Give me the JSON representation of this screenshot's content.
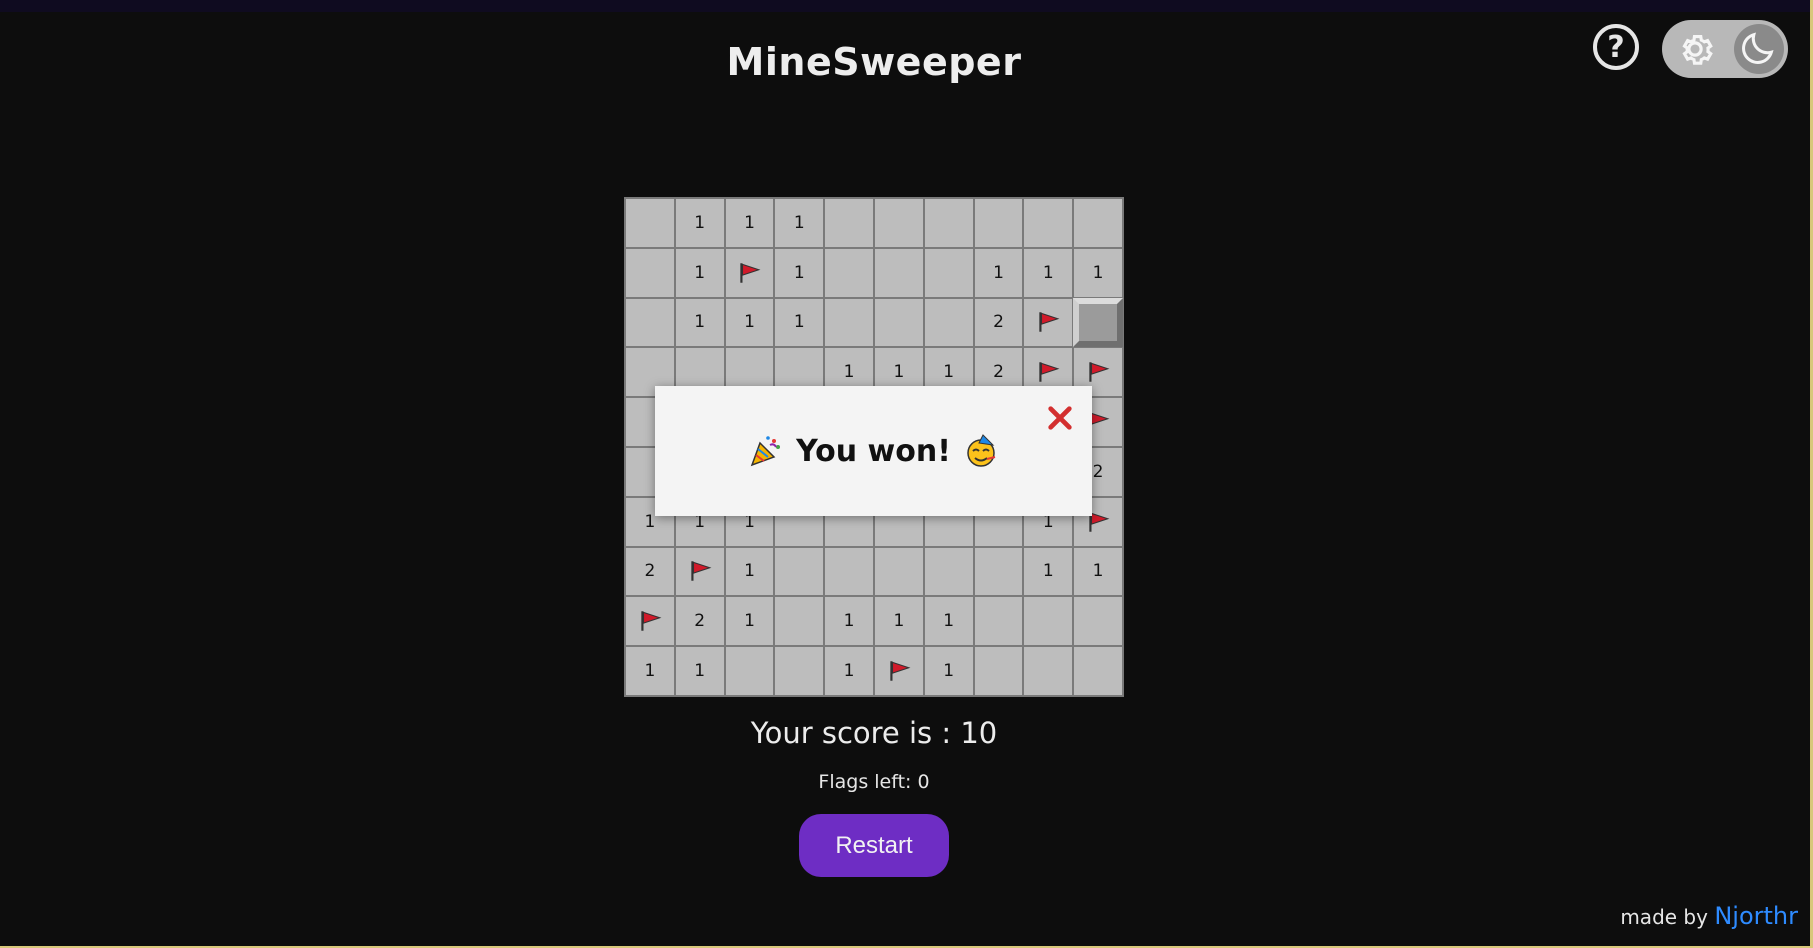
{
  "app": {
    "title": "MineSweeper"
  },
  "header": {
    "help_icon": "question-circle-icon",
    "help_label": "?",
    "theme_toggle": {
      "left_icon": "gear-icon",
      "right_icon": "moon-icon",
      "state": "dark"
    }
  },
  "board": {
    "rows": 10,
    "cols": 10,
    "cells": [
      [
        "",
        "1",
        "1",
        "1",
        "",
        "",
        "",
        "",
        "",
        ""
      ],
      [
        "",
        "1",
        "F",
        "1",
        "",
        "",
        "",
        "1",
        "1",
        "1"
      ],
      [
        "",
        "1",
        "1",
        "1",
        "",
        "",
        "",
        "2",
        "F",
        "#"
      ],
      [
        "",
        "",
        "",
        "",
        "1",
        "1",
        "1",
        "2",
        "F",
        "F"
      ],
      [
        "",
        "",
        "",
        "",
        "",
        "",
        "",
        "",
        "",
        "F"
      ],
      [
        "",
        "",
        "",
        "",
        "",
        "",
        "",
        "",
        "",
        "2"
      ],
      [
        "1",
        "1",
        "1",
        "",
        "",
        "",
        "",
        "",
        "1",
        "F"
      ],
      [
        "2",
        "F",
        "1",
        "",
        "",
        "",
        "",
        "",
        "1",
        "1"
      ],
      [
        "F",
        "2",
        "1",
        "",
        "1",
        "1",
        "1",
        "",
        "",
        ""
      ],
      [
        "1",
        "1",
        "",
        "",
        "1",
        "F",
        "1",
        "",
        "",
        ""
      ]
    ],
    "legend": {
      "F": "flag-icon",
      "#": "unrevealed-cell"
    },
    "colors": {
      "cell_bg": "#bdbdbd",
      "grid_line": "#7a7a7a",
      "flag": "#d11a2a"
    }
  },
  "modal": {
    "message": "You won!",
    "left_emoji": "party-popper-icon",
    "right_emoji": "partying-face-icon",
    "close_icon": "close-icon"
  },
  "status": {
    "score_text": "Your score is : 10",
    "flags_text": "Flags left: 0"
  },
  "actions": {
    "restart_label": "Restart",
    "restart_color": "#6e2dc4"
  },
  "footer": {
    "made_by": "made by",
    "author": "Njorthr",
    "author_color": "#2e8bff"
  }
}
